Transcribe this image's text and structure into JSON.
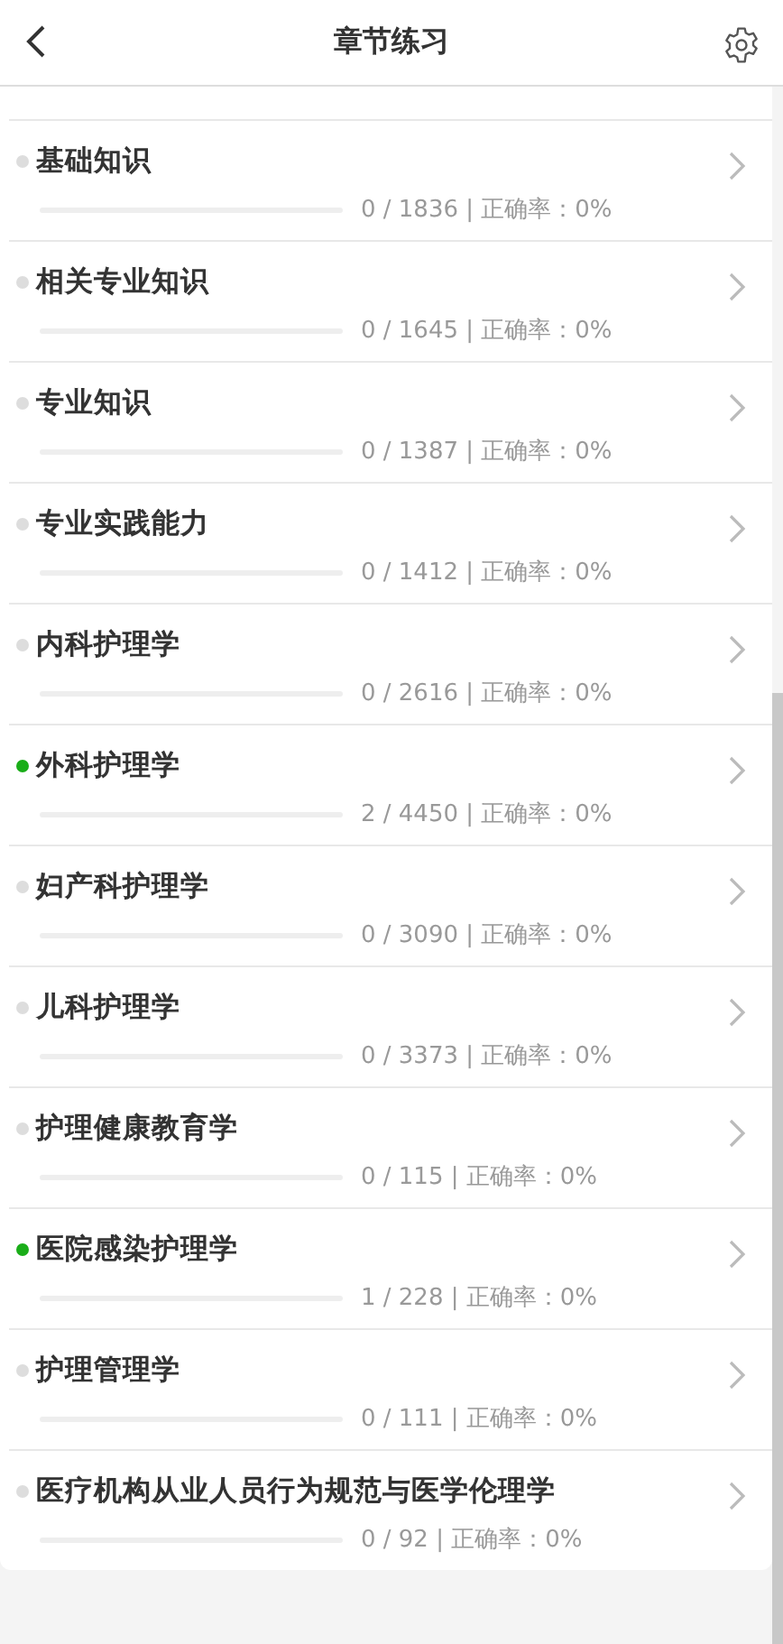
{
  "header": {
    "title": "章节练习"
  },
  "chapters": [
    {
      "name": "基础知识",
      "stats": "0 / 1836 | 正确率：0%",
      "color": "#dddddd"
    },
    {
      "name": "相关专业知识",
      "stats": "0 / 1645 | 正确率：0%",
      "color": "#dddddd"
    },
    {
      "name": "专业知识",
      "stats": "0 / 1387 | 正确率：0%",
      "color": "#dddddd"
    },
    {
      "name": "专业实践能力",
      "stats": "0 / 1412 | 正确率：0%",
      "color": "#dddddd"
    },
    {
      "name": "内科护理学",
      "stats": "0 / 2616 | 正确率：0%",
      "color": "#dddddd"
    },
    {
      "name": "外科护理学",
      "stats": "2 / 4450 | 正确率：0%",
      "color": "#1aad19"
    },
    {
      "name": "妇产科护理学",
      "stats": "0 / 3090 | 正确率：0%",
      "color": "#dddddd"
    },
    {
      "name": "儿科护理学",
      "stats": "0 / 3373 | 正确率：0%",
      "color": "#dddddd"
    },
    {
      "name": "护理健康教育学",
      "stats": "0 / 115 | 正确率：0%",
      "color": "#dddddd"
    },
    {
      "name": "医院感染护理学",
      "stats": "1 / 228 | 正确率：0%",
      "color": "#1aad19"
    },
    {
      "name": "护理管理学",
      "stats": "0 / 111 | 正确率：0%",
      "color": "#dddddd"
    },
    {
      "name": "医疗机构从业人员行为规范与医学伦理学",
      "stats": "0 / 92 | 正确率：0%",
      "color": "#dddddd"
    }
  ]
}
